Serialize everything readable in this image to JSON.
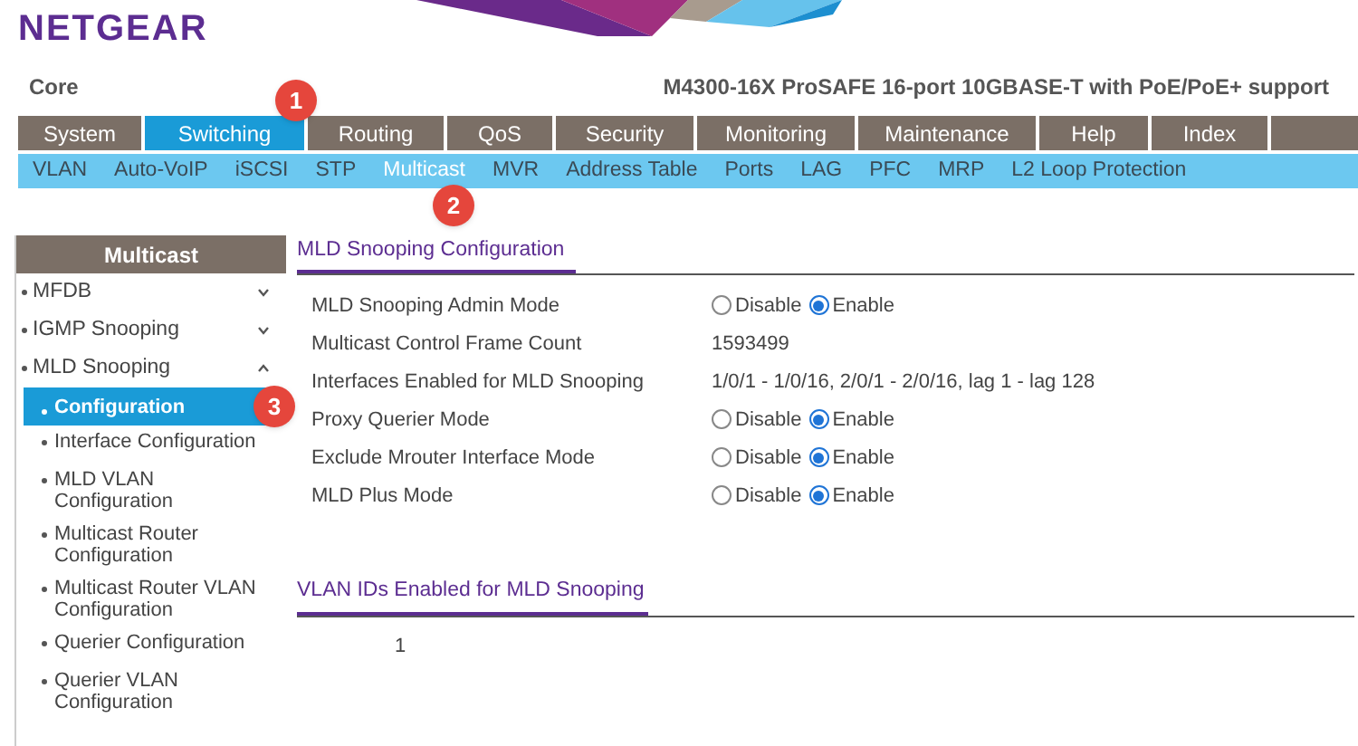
{
  "logo": "NETGEAR",
  "context": "Core",
  "device": "M4300-16X ProSAFE 16-port 10GBASE-T with PoE/PoE+ support",
  "tabs": [
    {
      "label": "System",
      "selected": false
    },
    {
      "label": "Switching",
      "selected": true
    },
    {
      "label": "Routing",
      "selected": false
    },
    {
      "label": "QoS",
      "selected": false
    },
    {
      "label": "Security",
      "selected": false
    },
    {
      "label": "Monitoring",
      "selected": false
    },
    {
      "label": "Maintenance",
      "selected": false
    },
    {
      "label": "Help",
      "selected": false
    },
    {
      "label": "Index",
      "selected": false
    }
  ],
  "subtabs": [
    {
      "label": "VLAN",
      "selected": false
    },
    {
      "label": "Auto-VoIP",
      "selected": false
    },
    {
      "label": "iSCSI",
      "selected": false
    },
    {
      "label": "STP",
      "selected": false
    },
    {
      "label": "Multicast",
      "selected": true
    },
    {
      "label": "MVR",
      "selected": false
    },
    {
      "label": "Address Table",
      "selected": false
    },
    {
      "label": "Ports",
      "selected": false
    },
    {
      "label": "LAG",
      "selected": false
    },
    {
      "label": "PFC",
      "selected": false
    },
    {
      "label": "MRP",
      "selected": false
    },
    {
      "label": "L2 Loop Protection",
      "selected": false
    }
  ],
  "sidebar": {
    "title": "Multicast",
    "items": [
      {
        "label": "MFDB",
        "expanded": false
      },
      {
        "label": "IGMP Snooping",
        "expanded": false
      },
      {
        "label": "MLD Snooping",
        "expanded": true,
        "children": [
          {
            "label": "Configuration",
            "selected": true
          },
          {
            "label": "Interface Configuration",
            "selected": false
          },
          {
            "label": "MLD VLAN Configuration",
            "selected": false
          },
          {
            "label": "Multicast Router Configuration",
            "selected": false
          },
          {
            "label": "Multicast Router VLAN Configuration",
            "selected": false
          },
          {
            "label": "Querier Configuration",
            "selected": false
          },
          {
            "label": "Querier VLAN Configuration",
            "selected": false
          }
        ]
      }
    ]
  },
  "config": {
    "title": "MLD Snooping Configuration",
    "rows": [
      {
        "label": "MLD Snooping Admin Mode",
        "kind": "radio",
        "options": [
          {
            "label": "Disable",
            "selected": false
          },
          {
            "label": "Enable",
            "selected": true
          }
        ]
      },
      {
        "label": "Multicast Control Frame Count",
        "kind": "text",
        "value": "1593499"
      },
      {
        "label": "Interfaces Enabled for MLD Snooping",
        "kind": "text",
        "value": "1/0/1 - 1/0/16, 2/0/1 - 2/0/16, lag 1 - lag 128"
      },
      {
        "label": "Proxy Querier Mode",
        "kind": "radio",
        "options": [
          {
            "label": "Disable",
            "selected": false
          },
          {
            "label": "Enable",
            "selected": true
          }
        ]
      },
      {
        "label": "Exclude Mrouter Interface Mode",
        "kind": "radio",
        "options": [
          {
            "label": "Disable",
            "selected": false
          },
          {
            "label": "Enable",
            "selected": true
          }
        ]
      },
      {
        "label": "MLD Plus Mode",
        "kind": "radio",
        "options": [
          {
            "label": "Disable",
            "selected": false
          },
          {
            "label": "Enable",
            "selected": true
          }
        ]
      }
    ]
  },
  "vlans": {
    "title": "VLAN IDs Enabled for MLD Snooping",
    "items": [
      "1"
    ]
  },
  "annotations": [
    "1",
    "2",
    "3"
  ]
}
